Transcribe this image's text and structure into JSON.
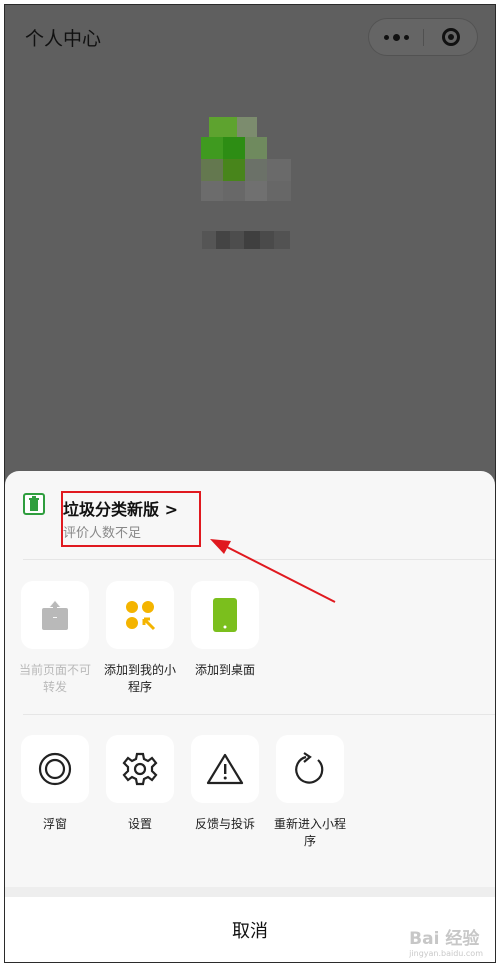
{
  "page": {
    "title": "个人中心"
  },
  "capsule": {
    "more_icon": "more-dots-icon",
    "close_icon": "target-close-icon"
  },
  "sheet": {
    "app": {
      "name": "垃圾分类新版 >",
      "subtitle": "评价人数不足",
      "icon": "trash-bin-icon"
    },
    "row1": [
      {
        "label": "当前页面不可转发",
        "icon": "share-up-icon",
        "disabled": true
      },
      {
        "label": "添加到我的小程序",
        "icon": "mini-program-add-icon",
        "disabled": false
      },
      {
        "label": "添加到桌面",
        "icon": "phone-desktop-icon",
        "disabled": false
      }
    ],
    "row2": [
      {
        "label": "浮窗",
        "icon": "float-window-icon"
      },
      {
        "label": "设置",
        "icon": "settings-gear-icon"
      },
      {
        "label": "反馈与投诉",
        "icon": "warning-triangle-icon"
      },
      {
        "label": "重新进入小程序",
        "icon": "reload-icon"
      }
    ],
    "cancel_label": "取消"
  },
  "watermark": {
    "text": "Bai 经验",
    "sub": "jingyan.baidu.com"
  },
  "colors": {
    "overlay": "#5f5f5f",
    "sheet": "#f7f7f7",
    "accent_yellow": "#f4b400",
    "accent_green": "#7bbf1d",
    "annotation_red": "#e0191f"
  }
}
